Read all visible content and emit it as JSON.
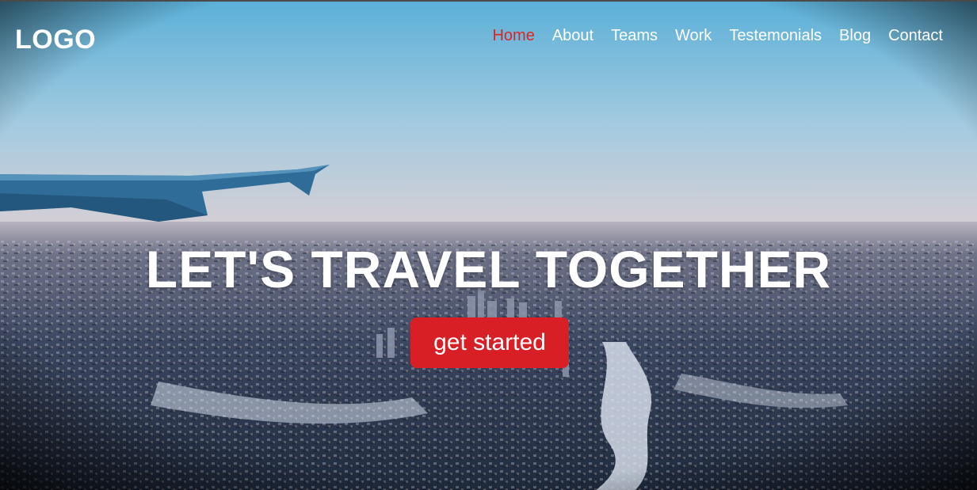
{
  "nav": {
    "logo": "LOGO",
    "items": [
      {
        "label": "Home",
        "active": true
      },
      {
        "label": "About",
        "active": false
      },
      {
        "label": "Teams",
        "active": false
      },
      {
        "label": "Work",
        "active": false
      },
      {
        "label": "Testemonials",
        "active": false
      },
      {
        "label": "Blog",
        "active": false
      },
      {
        "label": "Contact",
        "active": false
      }
    ],
    "active_color": "#e02424"
  },
  "hero": {
    "headline": "LET'S TRAVEL TOGETHER",
    "cta_label": "get started",
    "cta_color": "#d81f26",
    "background_image": "aerial-city-from-airplane-window"
  }
}
